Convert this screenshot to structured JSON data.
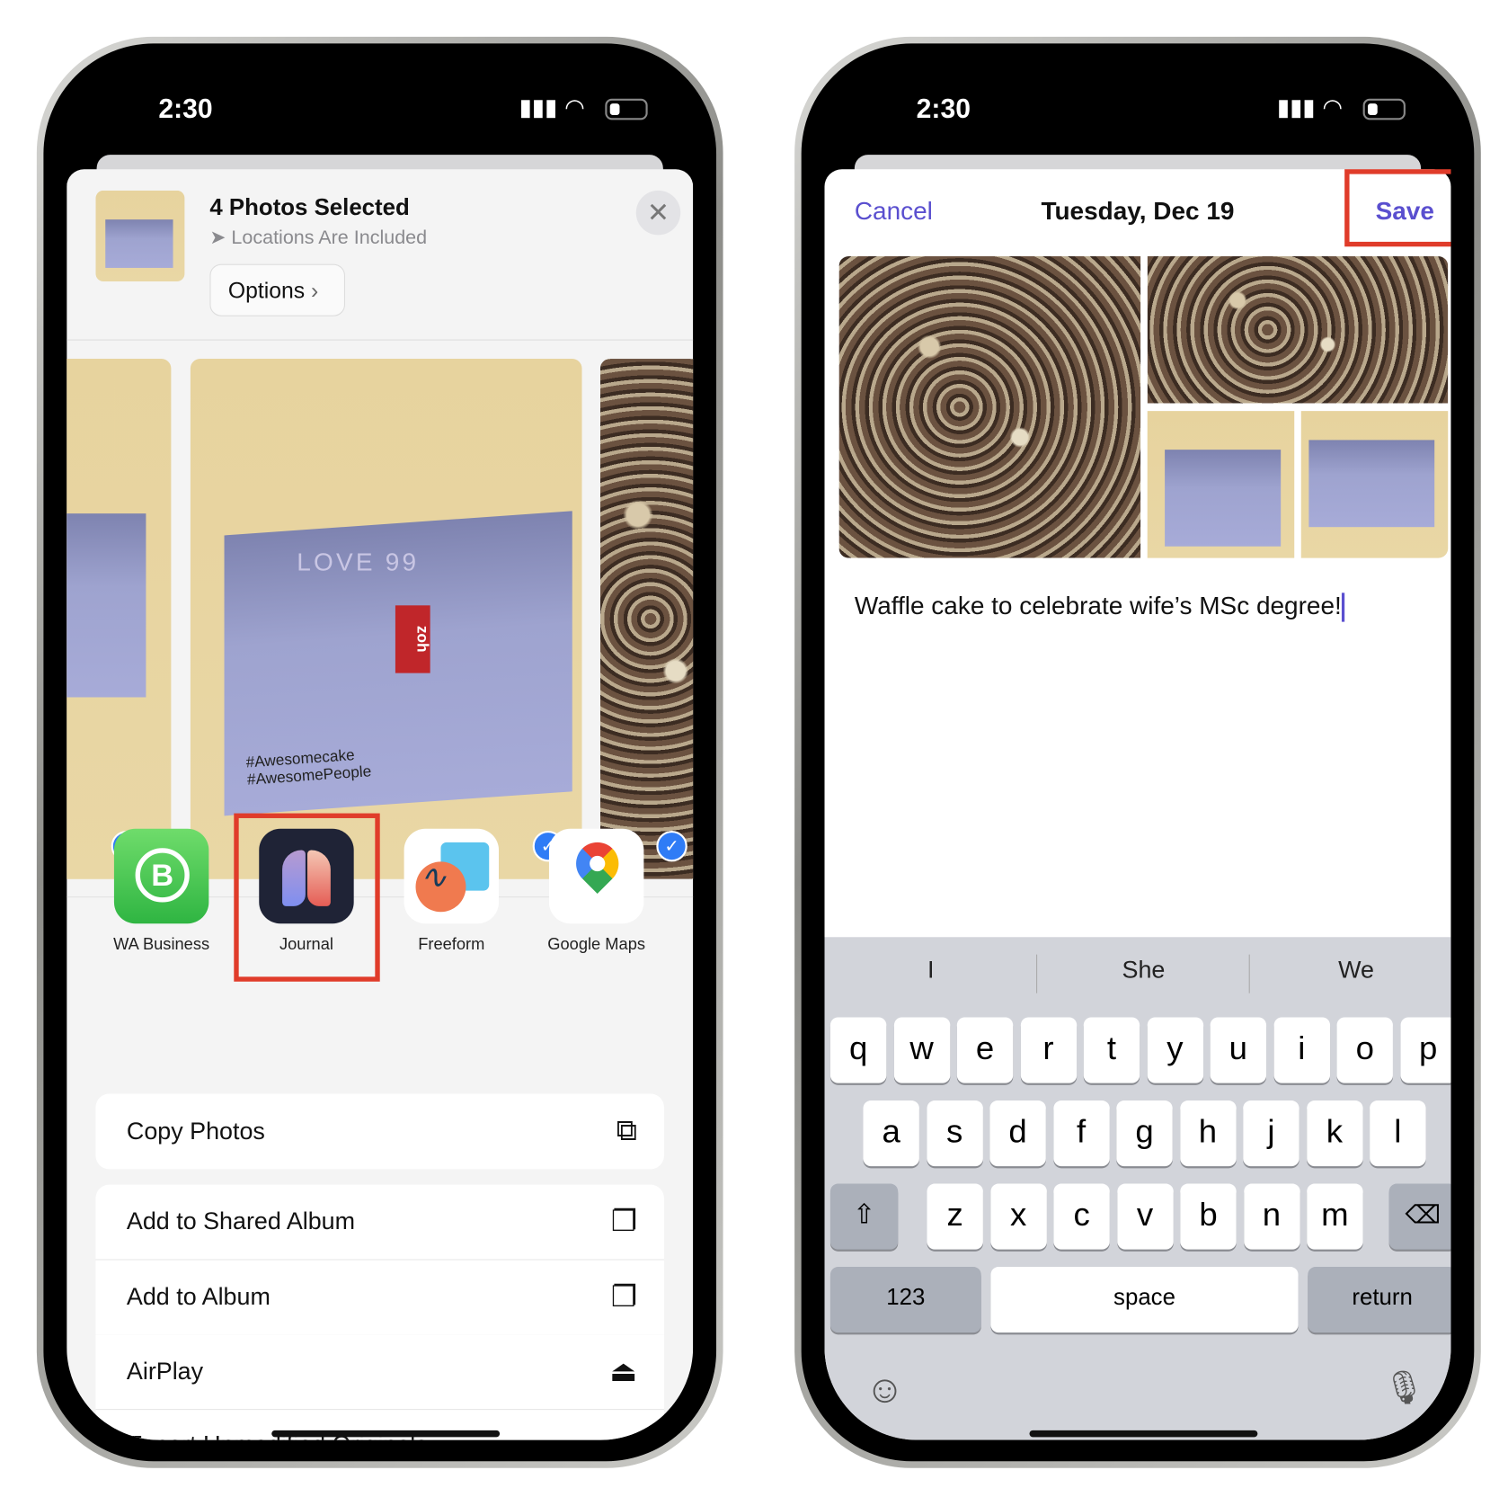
{
  "left_phone": {
    "status": {
      "time": "2:30"
    },
    "share_sheet": {
      "title": "4 Photos Selected",
      "subtitle": "Locations Are Included",
      "options_label": "Options",
      "apps": [
        {
          "label": "WA Business",
          "icon": "whatsapp-business-icon"
        },
        {
          "label": "Journal",
          "icon": "journal-icon",
          "highlighted": true
        },
        {
          "label": "Freeform",
          "icon": "freeform-icon"
        },
        {
          "label": "Google Maps",
          "icon": "google-maps-icon"
        }
      ],
      "photo_text": {
        "brand": "LOVE 99",
        "tag1": "#Awesomecake",
        "tag2": "#AwesomePeople",
        "label": "zoh"
      },
      "actions": [
        {
          "label": "Copy Photos",
          "icon": "copy-icon"
        },
        {
          "label": "Add to Shared Album",
          "icon": "shared-album-icon"
        },
        {
          "label": "Add to Album",
          "icon": "add-album-icon"
        },
        {
          "label": "AirPlay",
          "icon": "airplay-icon"
        },
        {
          "label": "Export Unmodified Originals",
          "icon": "folder-icon"
        }
      ]
    }
  },
  "right_phone": {
    "status": {
      "time": "2:30"
    },
    "nav": {
      "cancel": "Cancel",
      "title": "Tuesday, Dec 19",
      "save": "Save"
    },
    "entry_text": "Waffle cake to celebrate wife’s MSc degree!",
    "keyboard": {
      "suggestions": [
        "I",
        "She",
        "We"
      ],
      "row1": [
        "q",
        "w",
        "e",
        "r",
        "t",
        "y",
        "u",
        "i",
        "o",
        "p"
      ],
      "row2": [
        "a",
        "s",
        "d",
        "f",
        "g",
        "h",
        "j",
        "k",
        "l"
      ],
      "row3": [
        "z",
        "x",
        "c",
        "v",
        "b",
        "n",
        "m"
      ],
      "numbers": "123",
      "space": "space",
      "return": "return"
    }
  },
  "colors": {
    "accent": "#5a4fcf",
    "highlight": "#e03c2a",
    "check": "#2f7cf6"
  }
}
